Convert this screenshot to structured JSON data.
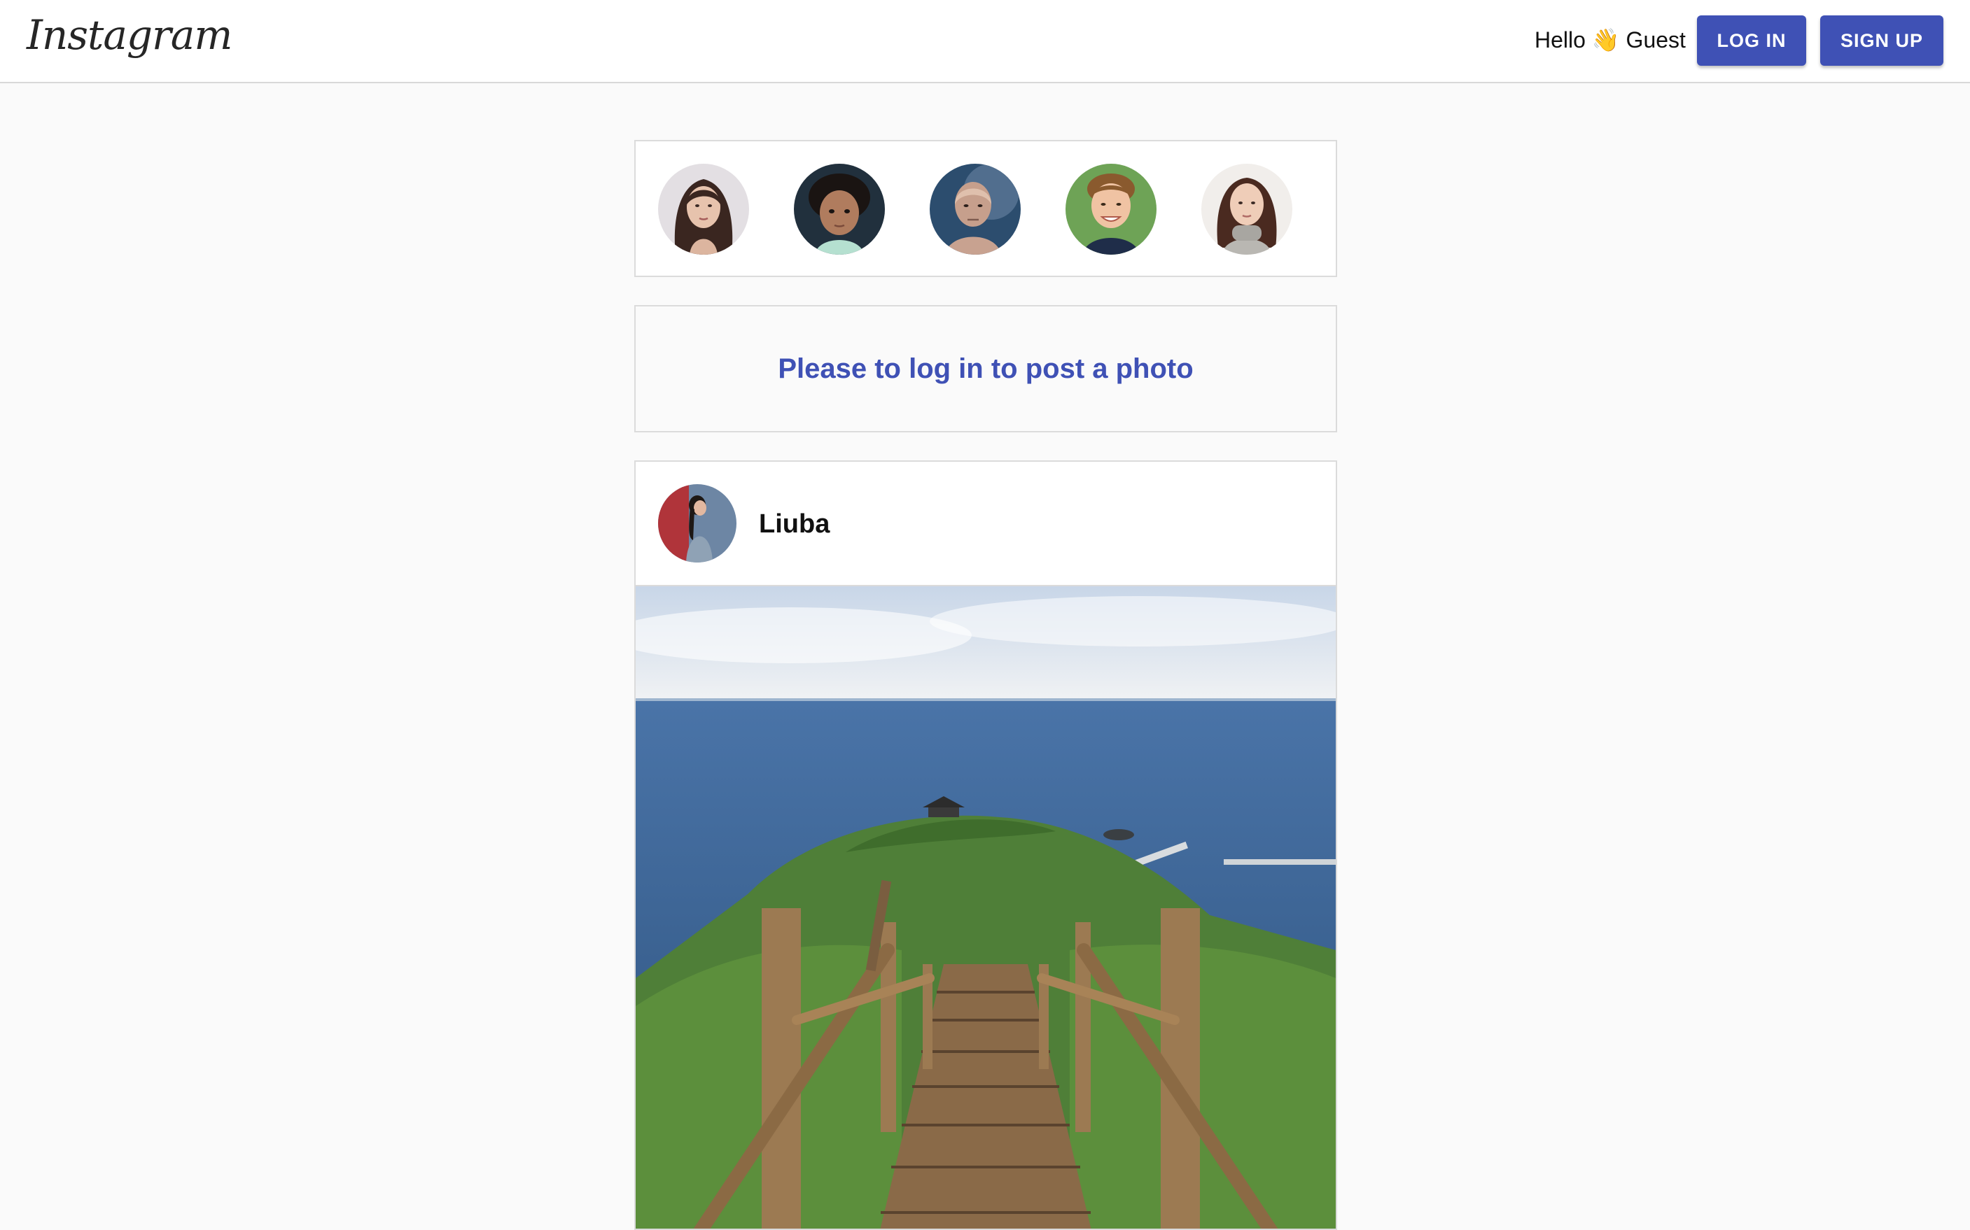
{
  "header": {
    "logo": "Instagram",
    "greeting_hello": "Hello",
    "greeting_emoji": "👋",
    "greeting_name": "Guest",
    "login_label": "LOG IN",
    "signup_label": "SIGN UP"
  },
  "stories": [
    {
      "name": "story-woman-dark-hair"
    },
    {
      "name": "story-child-curly-hair"
    },
    {
      "name": "story-bald-man"
    },
    {
      "name": "story-smiling-boy"
    },
    {
      "name": "story-woman-turtleneck"
    },
    {
      "name": "story-partial"
    }
  ],
  "notice": {
    "text": "Please to log in to post a photo"
  },
  "post": {
    "username": "Liuba"
  },
  "colors": {
    "accent": "#3f51b5",
    "background": "#fafafa",
    "border": "#dbdbdb"
  }
}
